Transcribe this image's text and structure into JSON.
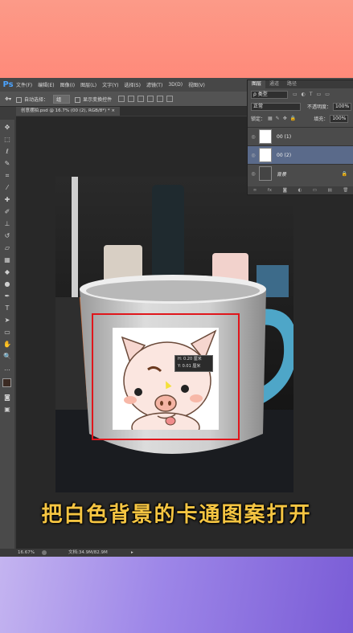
{
  "app": {
    "logo": "Ps"
  },
  "menu": [
    "文件(F)",
    "编辑(E)",
    "图像(I)",
    "图层(L)",
    "文字(Y)",
    "选择(S)",
    "滤镜(T)",
    "3D(D)",
    "视图(V)"
  ],
  "options": {
    "auto_select_label": "自动选择：",
    "auto_select_value": "组",
    "show_transform_label": "显示变换控件"
  },
  "document_tab": {
    "title": "创意摆拍.psd @ 16.7% (00 (2), RGB/8*) *",
    "close": "×"
  },
  "layers_panel": {
    "tabs": [
      "图层",
      "通道",
      "路径"
    ],
    "filter_value": "ρ 类型",
    "blend_mode": "正常",
    "opacity_label": "不透明度：",
    "opacity_value": "100%",
    "lock_label": "锁定：",
    "fill_label": "填充：",
    "fill_value": "100%",
    "layers": [
      {
        "name": "00 (1)"
      },
      {
        "name": "00 (2)"
      },
      {
        "name": "背景"
      }
    ],
    "footer": [
      "∞",
      "fx",
      "◙",
      "◐",
      "▭",
      "▤",
      "🗑"
    ]
  },
  "tooltip": {
    "line1": "H: 0.20 厘米",
    "line2": "Y: 0.01 厘米"
  },
  "statusbar": {
    "zoom": "16.67%",
    "doc_info": "文档:34.9M/82.9M"
  },
  "caption": "把白色背景的卡通图案打开",
  "colors": {
    "caption": "#f5c542",
    "highlight_box": "#e0161b",
    "ps_blue": "#4aa3ff"
  }
}
